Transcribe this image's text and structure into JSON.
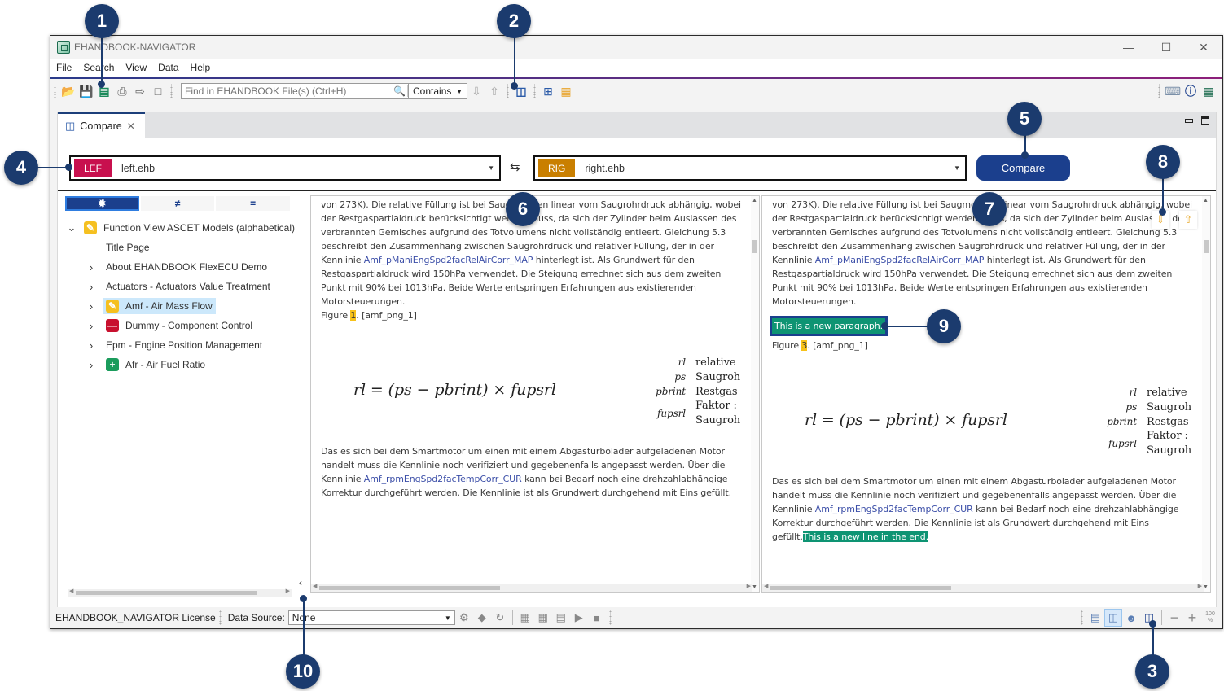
{
  "window": {
    "title": "EHANDBOOK-NAVIGATOR",
    "controls": {
      "minimize": "—",
      "maximize": "☐",
      "close": "✕"
    }
  },
  "menu": [
    "File",
    "Search",
    "View",
    "Data",
    "Help"
  ],
  "toolbar": {
    "icons": [
      "open-folder-icon",
      "save-icon",
      "document-outline-icon",
      "print-icon",
      "export-icon",
      "pdf-icon"
    ],
    "search_placeholder": "Find in EHANDBOOK File(s) (Ctrl+H)",
    "search_value": "",
    "match_mode": "Contains",
    "nav_icons": [
      "next-result-icon",
      "previous-result-icon"
    ],
    "compare_icon": "compare-icon",
    "extra_icons": [
      "add-model-icon",
      "add-window-icon"
    ],
    "right_icons": [
      "keyboard-icon",
      "help-icon",
      "ehandbook-icon"
    ]
  },
  "editor": {
    "tab_label": "Compare",
    "left_file": {
      "tag": "LEF",
      "name": "left.ehb",
      "color": "#c8104e"
    },
    "right_file": {
      "tag": "RIG",
      "name": "right.ehb",
      "color": "#c97f00"
    },
    "compare_button": "Compare"
  },
  "tree": {
    "filters": [
      {
        "name": "all-changes",
        "symbol": "✹"
      },
      {
        "name": "differences",
        "symbol": "≠"
      },
      {
        "name": "equal",
        "symbol": "="
      }
    ],
    "items": [
      {
        "label": "Function View ASCET Models (alphabetical)",
        "expander": "⌄",
        "status": "modified",
        "level": 0
      },
      {
        "label": "Title Page",
        "expander": "",
        "status": "",
        "level": 1
      },
      {
        "label": "About EHANDBOOK FlexECU Demo",
        "expander": "›",
        "status": "",
        "level": 1
      },
      {
        "label": "Actuators - Actuators Value Treatment",
        "expander": "›",
        "status": "",
        "level": 1
      },
      {
        "label": "Amf - Air Mass Flow",
        "expander": "›",
        "status": "modified",
        "level": 1,
        "selected": true
      },
      {
        "label": "Dummy - Component Control",
        "expander": "›",
        "status": "deleted",
        "level": 1
      },
      {
        "label": "Epm - Engine Position Management",
        "expander": "›",
        "status": "",
        "level": 1
      },
      {
        "label": "Afr - Air Fuel Ratio",
        "expander": "›",
        "status": "added",
        "level": 1
      }
    ]
  },
  "doc": {
    "para1_a": "von 273K). Die relative Füllung ist bei Saugmotoren linear vom Saugrohrdruck abhängig, wobei der Restgaspartialdruck berücksichtigt werden muss, da sich der Zylinder beim Auslassen des verbrannten Gemisches aufgrund des Totvolumens nicht vollständig entleert. Gleichung 5.3 beschreibt den Zusammenhang zwischen Saugrohrdruck und relativer Füllung, der in der Kennlinie ",
    "para1_link": "Amf_pManiEngSpd2facRelAirCorr_MAP",
    "para1_b": " hinterlegt ist. Als Grundwert für den Restgaspartialdruck wird 150hPa verwendet. Die Steigung errechnet sich aus dem zweiten Punkt mit 90% bei 1013hPa. Beide Werte entspringen Erfahrungen aus existierenden Motorsteuerungen.",
    "figure_prefix": "Figure ",
    "figure_suffix": ". [amf_png_1]",
    "left_figure_number": "1",
    "right_figure_number": "3",
    "new_paragraph": "This is a new paragraph.",
    "formula": "rl = (ps − pbrint) × fupsrl",
    "legend": [
      {
        "symbol": "rl",
        "desc": "relative"
      },
      {
        "symbol": "ps",
        "desc": "Saugroh"
      },
      {
        "symbol": "pbrint",
        "desc": "Restgas"
      },
      {
        "symbol": "fupsrl",
        "desc": "Faktor :",
        "desc2": "Saugroh"
      }
    ],
    "para2_a": " Das es sich bei dem Smartmotor um einen mit einem Abgasturbolader aufgeladenen Motor handelt muss die Kennlinie noch verifiziert und gegebenenfalls angepasst werden. Über die Kennlinie ",
    "para2_link": "Amf_rpmEngSpd2facTempCorr_CUR",
    "para2_b": " kann bei Bedarf noch eine drehzahlabhängige Korrektur durchgeführt werden. Die Kennlinie ist als Grundwert durchgehend mit Eins gefüllt.",
    "new_line": "This is a new line in the end.",
    "nav_down": "⇩",
    "nav_up": "⇧"
  },
  "statusbar": {
    "license": "EHANDBOOK_NAVIGATOR License",
    "data_source_label": "Data Source:",
    "data_source_value": "None",
    "zoom_label": "100\n%",
    "zoom_out": "−",
    "zoom_in": "+"
  },
  "callouts": [
    "1",
    "2",
    "3",
    "4",
    "5",
    "6",
    "7",
    "8",
    "9",
    "10"
  ]
}
